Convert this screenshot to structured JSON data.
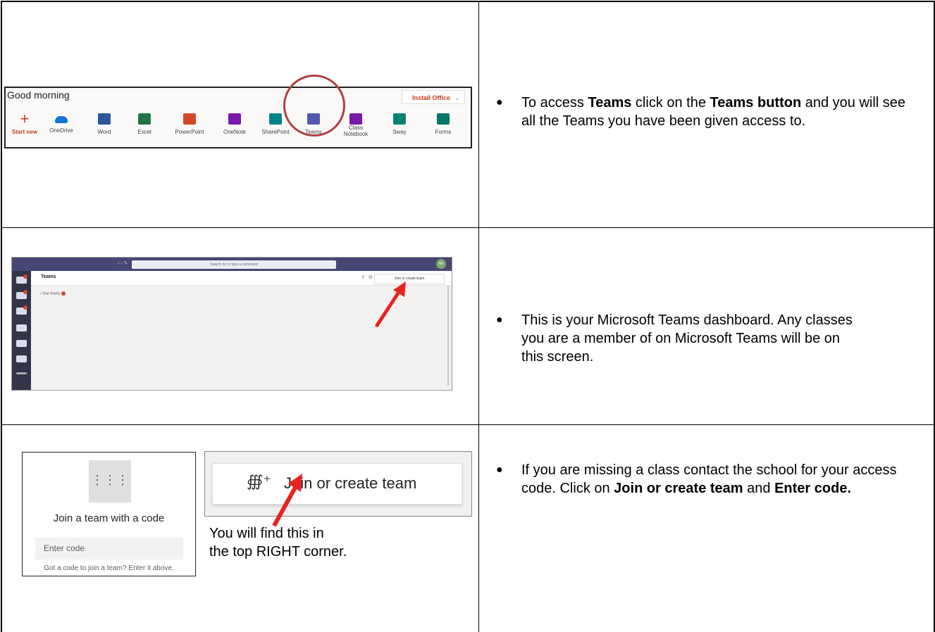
{
  "rows": [
    {
      "instruction": {
        "prefix": "To access ",
        "bold1": "Teams",
        "middle": " click on the ",
        "bold2": "Teams button",
        "suffix": " and you will see all the Teams you have been given access to."
      },
      "office": {
        "greeting": "Good morning",
        "install_label": "Install Office",
        "apps": [
          {
            "label": "Start new",
            "color": "#c43e1c",
            "icon": "plus-icon"
          },
          {
            "label": "OneDrive",
            "color": "#0f78d4",
            "icon": "onedrive-icon"
          },
          {
            "label": "Word",
            "color": "#2b579a",
            "icon": "word-icon"
          },
          {
            "label": "Excel",
            "color": "#217346",
            "icon": "excel-icon"
          },
          {
            "label": "PowerPoint",
            "color": "#d24726",
            "icon": "powerpoint-icon"
          },
          {
            "label": "OneNote",
            "color": "#7719aa",
            "icon": "onenote-icon"
          },
          {
            "label": "SharePoint",
            "color": "#038387",
            "icon": "sharepoint-icon"
          },
          {
            "label": "Teams",
            "color": "#5558af",
            "icon": "teams-icon"
          },
          {
            "label": "Class Notebook",
            "color": "#7719aa",
            "icon": "class-notebook-icon"
          },
          {
            "label": "Sway",
            "color": "#008272",
            "icon": "sway-icon"
          },
          {
            "label": "Forms",
            "color": "#077568",
            "icon": "forms-icon"
          }
        ]
      }
    },
    {
      "instruction": {
        "text": "This is your Microsoft Teams dashboard. Any classes you are a member of on Microsoft Teams will be on this screen."
      },
      "teams_ui": {
        "search_placeholder": "Search for or type a command",
        "title": "Teams",
        "join_label": "Join or create team",
        "your_teams": "Your teams",
        "avatar_initials": "AK"
      }
    },
    {
      "instruction": {
        "prefix": "If you are missing a class contact the school for your access code. Click on ",
        "bold1": "Join or create team",
        "middle": " and ",
        "bold2": "Enter code."
      },
      "join_card": {
        "heading": "Join a team with a code",
        "placeholder": "Enter code",
        "help": "Got a code to join a team? Enter it above."
      },
      "join_button": {
        "label": "Join or create team"
      },
      "note": {
        "line1": "You will find this in",
        "line2": "the top RIGHT corner."
      }
    }
  ],
  "colors": {
    "highlight_circle": "#b04040",
    "arrow": "#e8231f",
    "teams_purple": "#464775"
  }
}
